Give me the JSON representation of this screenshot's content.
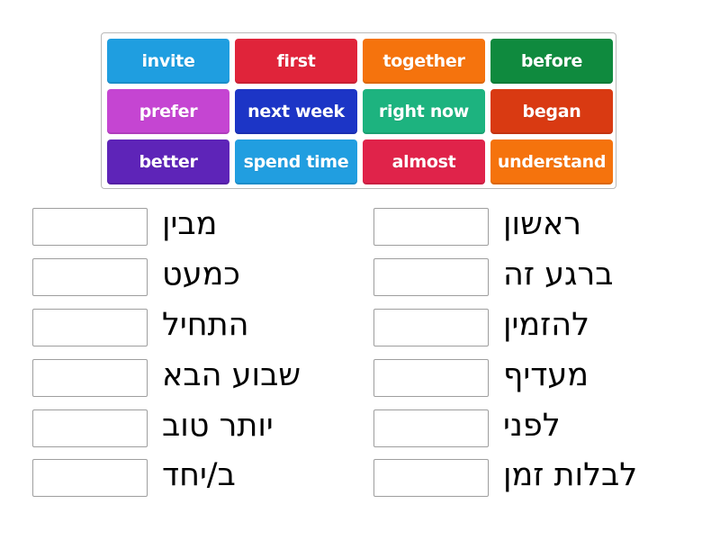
{
  "tiles": [
    {
      "label": "invite",
      "color": "#1f9ee0"
    },
    {
      "label": "first",
      "color": "#e0243a"
    },
    {
      "label": "together",
      "color": "#f5730d"
    },
    {
      "label": "before",
      "color": "#0f8a3e"
    },
    {
      "label": "prefer",
      "color": "#c545d2"
    },
    {
      "label": "next week",
      "color": "#1c35c6"
    },
    {
      "label": "right now",
      "color": "#1db37f"
    },
    {
      "label": "began",
      "color": "#d93a12"
    },
    {
      "label": "better",
      "color": "#5e24b8"
    },
    {
      "label": "spend time",
      "color": "#219ee0"
    },
    {
      "label": "almost",
      "color": "#e0234a"
    },
    {
      "label": "understand",
      "color": "#f5730d"
    }
  ],
  "left_column": [
    {
      "hebrew": "מבין",
      "answer": ""
    },
    {
      "hebrew": "כמעט",
      "answer": ""
    },
    {
      "hebrew": "התחיל",
      "answer": ""
    },
    {
      "hebrew": "שבוע הבא",
      "answer": ""
    },
    {
      "hebrew": "יותר טוב",
      "answer": ""
    },
    {
      "hebrew": "ב/יחד",
      "answer": ""
    }
  ],
  "right_column": [
    {
      "hebrew": "ראשון",
      "answer": ""
    },
    {
      "hebrew": "ברגע זה",
      "answer": ""
    },
    {
      "hebrew": "להזמין",
      "answer": ""
    },
    {
      "hebrew": "מעדיף",
      "answer": ""
    },
    {
      "hebrew": "לפני",
      "answer": ""
    },
    {
      "hebrew": "לבלות זמן",
      "answer": ""
    }
  ]
}
